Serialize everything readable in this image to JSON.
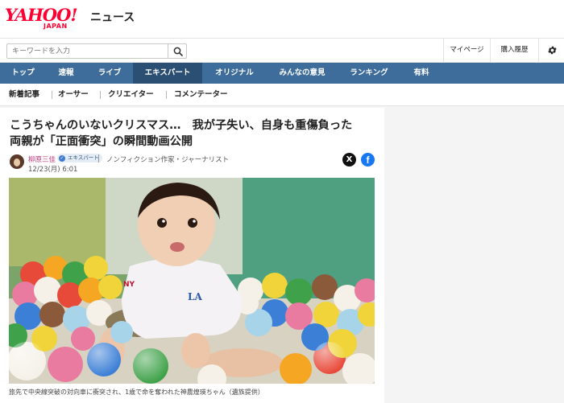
{
  "header": {
    "logo_main": "YAHOO!",
    "logo_sub": "JAPAN",
    "logo_news": "ニュース",
    "search_placeholder": "キーワードを入力",
    "mypage": "マイページ",
    "history": "購入履歴",
    "settings_icon": "gear-icon"
  },
  "main_nav": [
    {
      "label": "トップ"
    },
    {
      "label": "速報"
    },
    {
      "label": "ライブ"
    },
    {
      "label": "エキスパート",
      "active": true
    },
    {
      "label": "オリジナル"
    },
    {
      "label": "みんなの意見"
    },
    {
      "label": "ランキング"
    },
    {
      "label": "有料"
    }
  ],
  "sub_nav": [
    {
      "label": "新着記事"
    },
    {
      "label": "オーサー"
    },
    {
      "label": "クリエイター"
    },
    {
      "label": "コメンテーター"
    }
  ],
  "article": {
    "headline_line1": "こうちゃんのいないクリスマス…　我が子失い、自身も重傷負った",
    "headline_line2": "両親が「正面衝突」の瞬間動画公開",
    "author": "柳原三佳",
    "badge": "エキスパート",
    "author_title": "ノンフィクション作家・ジャーナリスト",
    "date": "12/23(月) 6:01",
    "share_x": "X",
    "share_facebook": "f",
    "caption": "旅先で中央線突破の対向車に衝突され、1歳で命を奪われた神農煌瑛ちゃん（遺族提供）"
  },
  "colors": {
    "brand_red": "#ff0033",
    "nav_blue": "#3e6d9c",
    "nav_active": "#2a4f73",
    "author_pink": "#c03a7a"
  }
}
